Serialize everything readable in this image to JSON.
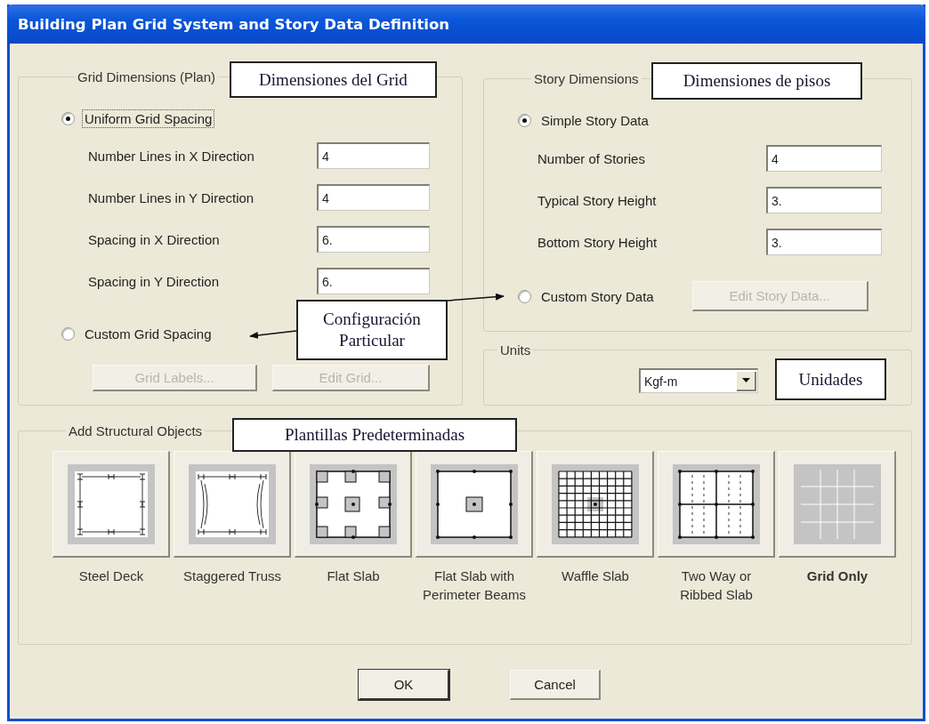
{
  "window": {
    "title": "Building Plan Grid System and Story Data Definition"
  },
  "grid_dimensions": {
    "legend": "Grid Dimensions (Plan)",
    "uniform_option": {
      "label": "Uniform Grid Spacing",
      "selected": true,
      "focused": true
    },
    "fields": [
      {
        "label": "Number Lines in X Direction",
        "value": "4"
      },
      {
        "label": "Number Lines in Y Direction",
        "value": "4"
      },
      {
        "label": "Spacing in X Direction",
        "value": "6."
      },
      {
        "label": "Spacing in Y Direction",
        "value": "6."
      }
    ],
    "custom_option": {
      "label": "Custom Grid Spacing",
      "selected": false,
      "focused": false
    },
    "buttons": [
      {
        "label": "Grid Labels...",
        "disabled": true
      },
      {
        "label": "Edit Grid...",
        "disabled": true
      }
    ]
  },
  "story_dimensions": {
    "legend": "Story Dimensions",
    "simple_option": {
      "label": "Simple Story Data",
      "selected": true,
      "focused": false
    },
    "fields": [
      {
        "label": "Number of Stories",
        "value": "4"
      },
      {
        "label": "Typical Story Height",
        "value": "3."
      },
      {
        "label": "Bottom Story Height",
        "value": "3."
      }
    ],
    "custom_option": {
      "label": "Custom Story Data",
      "selected": false,
      "focused": false
    },
    "button": {
      "label": "Edit Story Data...",
      "disabled": true
    }
  },
  "units": {
    "legend": "Units",
    "value": "Kgf-m"
  },
  "structural_objects": {
    "legend": "Add Structural Objects",
    "templates": [
      {
        "label": "Steel Deck",
        "kind": "steel-deck",
        "selected": false
      },
      {
        "label": "Staggered Truss",
        "kind": "staggered-truss",
        "selected": false
      },
      {
        "label": "Flat Slab",
        "kind": "flat-slab",
        "selected": false
      },
      {
        "label": "Flat Slab with Perimeter Beams",
        "kind": "flat-slab-beams",
        "selected": false
      },
      {
        "label": "Waffle Slab",
        "kind": "waffle-slab",
        "selected": false
      },
      {
        "label": "Two Way or Ribbed Slab",
        "kind": "two-way-slab",
        "selected": false
      },
      {
        "label": "Grid Only",
        "kind": "grid-only",
        "selected": true
      }
    ]
  },
  "buttons": [
    {
      "label": "OK",
      "default": true
    },
    {
      "label": "Cancel",
      "default": false
    }
  ],
  "annotations": [
    {
      "text": "Dimensiones del Grid",
      "kind": "label"
    },
    {
      "text": "Dimensiones de pisos",
      "kind": "label"
    },
    {
      "text": "Configuración Particular",
      "kind": "callout"
    },
    {
      "text": "Unidades",
      "kind": "label"
    },
    {
      "text": "Plantillas Predeterminadas",
      "kind": "label"
    }
  ]
}
